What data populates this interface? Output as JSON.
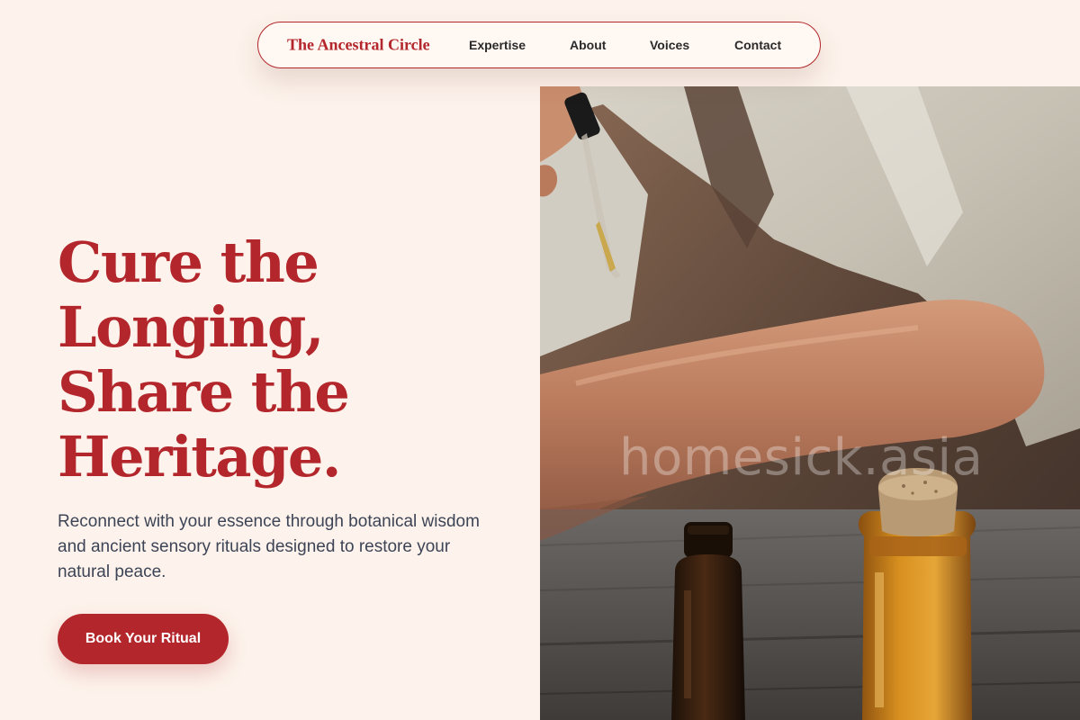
{
  "nav": {
    "brand": "The Ancestral Circle",
    "links": [
      "Expertise",
      "About",
      "Voices",
      "Contact"
    ]
  },
  "hero": {
    "title_lines": [
      "Cure the",
      "Longing,",
      "Share the",
      "Heritage."
    ],
    "subtitle": "Reconnect with your essence through botanical wisdom and ancient sensory rituals designed to restore your natural peace.",
    "cta_label": "Book Your Ritual"
  },
  "image": {
    "watermark": "homesick.asia"
  },
  "colors": {
    "background": "#fdf3ec",
    "accent": "#b3262b",
    "text_body": "#3d4456",
    "nav_text": "#2a2a2a"
  }
}
